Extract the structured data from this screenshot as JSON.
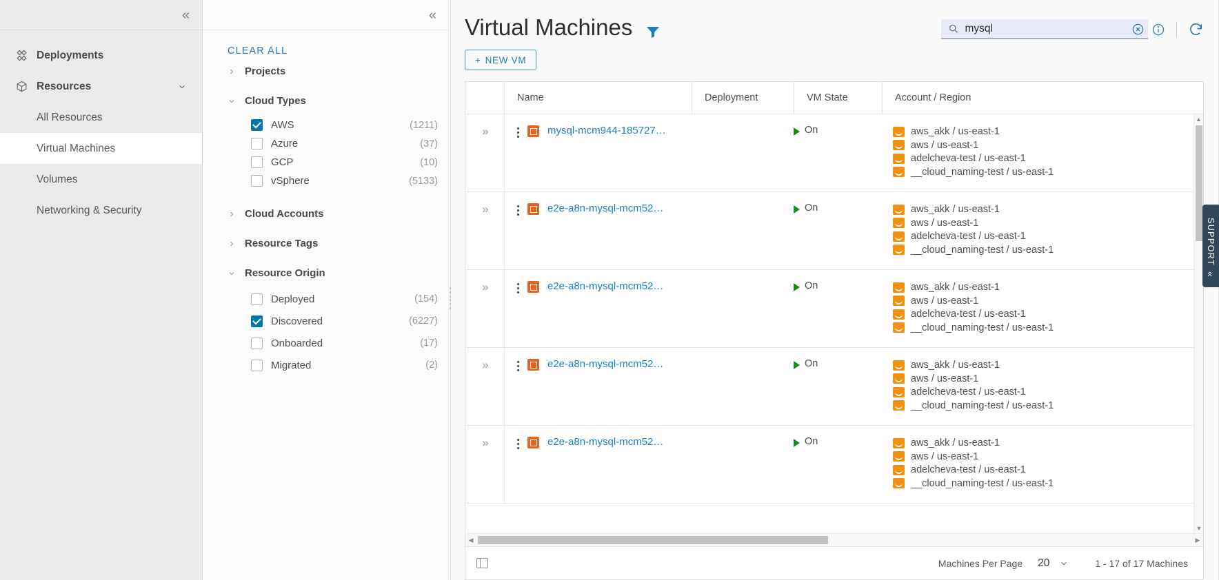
{
  "nav": {
    "collapse_icon": "chevron-double-left-icon",
    "items": [
      {
        "label": "Deployments",
        "icon": "deployments-icon",
        "bold": true
      },
      {
        "label": "Resources",
        "icon": "cube-icon",
        "bold": true,
        "expanded": true
      }
    ],
    "sub_items": [
      {
        "label": "All Resources",
        "active": false
      },
      {
        "label": "Virtual Machines",
        "active": true
      },
      {
        "label": "Volumes",
        "active": false
      },
      {
        "label": "Networking & Security",
        "active": false
      }
    ]
  },
  "filters": {
    "collapse_icon": "chevron-double-left-icon",
    "clear_all": "CLEAR ALL",
    "groups": [
      {
        "title": "Projects",
        "expanded": false,
        "options": []
      },
      {
        "title": "Cloud Types",
        "expanded": true,
        "options": [
          {
            "label": "AWS",
            "count": "(1211)",
            "checked": true
          },
          {
            "label": "Azure",
            "count": "(37)",
            "checked": false
          },
          {
            "label": "GCP",
            "count": "(10)",
            "checked": false
          },
          {
            "label": "vSphere",
            "count": "(5133)",
            "checked": false
          }
        ]
      },
      {
        "title": "Cloud Accounts",
        "expanded": false,
        "options": []
      },
      {
        "title": "Resource Tags",
        "expanded": false,
        "options": []
      },
      {
        "title": "Resource Origin",
        "expanded": true,
        "options": [
          {
            "label": "Deployed",
            "count": "(154)",
            "checked": false
          },
          {
            "label": "Discovered",
            "count": "(6227)",
            "checked": true
          },
          {
            "label": "Onboarded",
            "count": "(17)",
            "checked": false
          },
          {
            "label": "Migrated",
            "count": "(2)",
            "checked": false
          }
        ]
      }
    ]
  },
  "header": {
    "title": "Virtual Machines",
    "filter_icon": "funnel-filter-icon",
    "new_vm_label": "NEW VM",
    "new_vm_plus": "+"
  },
  "search": {
    "value": "mysql",
    "placeholder": "Search",
    "search_icon": "search-icon",
    "clear_icon": "clear-circle-x-icon",
    "info_icon": "info-circle-icon",
    "refresh_icon": "refresh-icon"
  },
  "table": {
    "columns": [
      "",
      "Name",
      "Deployment",
      "VM State",
      "Account / Region"
    ],
    "rows": [
      {
        "expand_icon": "expand-double-chevron-right-icon",
        "menu_icon": "kebab-menu-icon",
        "vm_icon": "virtual-machine-icon",
        "name": "mysql-mcm944-185727…",
        "deployment": "",
        "state": "On",
        "state_icon": "play-triangle-icon",
        "accounts": [
          "aws_akk / us-east-1",
          "aws / us-east-1",
          "adelcheva-test / us-east-1",
          "__cloud_naming-test / us-east-1"
        ]
      },
      {
        "expand_icon": "expand-double-chevron-right-icon",
        "menu_icon": "kebab-menu-icon",
        "vm_icon": "virtual-machine-icon",
        "name": "e2e-a8n-mysql-mcm52…",
        "deployment": "",
        "state": "On",
        "state_icon": "play-triangle-icon",
        "accounts": [
          "aws_akk / us-east-1",
          "aws / us-east-1",
          "adelcheva-test / us-east-1",
          "__cloud_naming-test / us-east-1"
        ]
      },
      {
        "expand_icon": "expand-double-chevron-right-icon",
        "menu_icon": "kebab-menu-icon",
        "vm_icon": "virtual-machine-icon",
        "name": "e2e-a8n-mysql-mcm52…",
        "deployment": "",
        "state": "On",
        "state_icon": "play-triangle-icon",
        "accounts": [
          "aws_akk / us-east-1",
          "aws / us-east-1",
          "adelcheva-test / us-east-1",
          "__cloud_naming-test / us-east-1"
        ]
      },
      {
        "expand_icon": "expand-double-chevron-right-icon",
        "menu_icon": "kebab-menu-icon",
        "vm_icon": "virtual-machine-icon",
        "name": "e2e-a8n-mysql-mcm52…",
        "deployment": "",
        "state": "On",
        "state_icon": "play-triangle-icon",
        "accounts": [
          "aws_akk / us-east-1",
          "aws / us-east-1",
          "adelcheva-test / us-east-1",
          "__cloud_naming-test / us-east-1"
        ]
      },
      {
        "expand_icon": "expand-double-chevron-right-icon",
        "menu_icon": "kebab-menu-icon",
        "vm_icon": "virtual-machine-icon",
        "name": "e2e-a8n-mysql-mcm52…",
        "deployment": "",
        "state": "On",
        "state_icon": "play-triangle-icon",
        "accounts": [
          "aws_akk / us-east-1",
          "aws / us-east-1",
          "adelcheva-test / us-east-1",
          "__cloud_naming-test / us-east-1"
        ]
      }
    ]
  },
  "footer": {
    "column_picker_icon": "column-picker-icon",
    "per_page_label": "Machines Per Page",
    "per_page_value": "20",
    "per_page_caret": "chevron-down-icon",
    "range_label": "1 - 17 of 17 Machines"
  },
  "support": {
    "label": "SUPPORT",
    "icon": "chevron-double-left-icon"
  },
  "colors": {
    "accent_blue": "#2a7ab0",
    "link_blue": "#1a7fc1",
    "checkbox_on": "#0078a8",
    "aws_orange": "#f29111",
    "vm_orange": "#e8621e",
    "state_green": "#1a8a1a",
    "support_navy": "#33475b"
  }
}
